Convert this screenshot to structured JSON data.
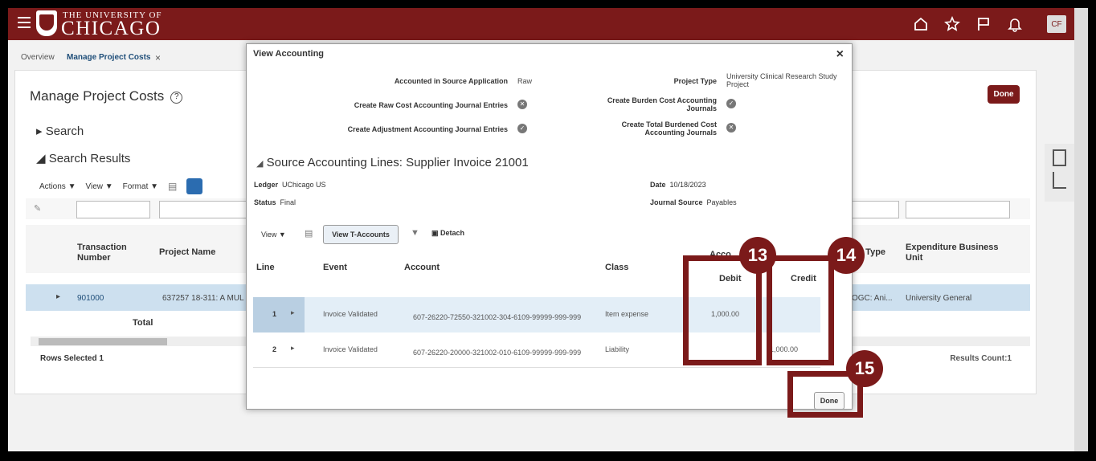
{
  "app": {
    "brand_top": "THE UNIVERSITY OF",
    "brand_main": "CHICAGO",
    "user_initials": "CF",
    "top_icons": [
      "home-icon",
      "star-icon",
      "flag-icon",
      "bell-icon"
    ]
  },
  "tabs": [
    {
      "label": "Overview"
    },
    {
      "label": "Manage Project Costs"
    }
  ],
  "page": {
    "title": "Manage Project Costs",
    "done_label": "Done",
    "search_label": "Search",
    "search_results_label": "Search Results",
    "toolbar": {
      "actions": "Actions",
      "view": "View",
      "format": "Format"
    },
    "headers": [
      "Transaction Number",
      "Project Name",
      "e Type",
      "Expenditure Business Unit"
    ],
    "row": {
      "transaction_number": "901000",
      "project_name": "637257 18-311: A MUL",
      "type_fragment": "OGC: Ani...",
      "business_unit": "University General"
    },
    "total_label": "Total",
    "rows_selected": "Rows Selected  1",
    "results_count": "Results Count:1"
  },
  "dialog": {
    "title": "View Accounting",
    "accounted_label": "Accounted in Source Application",
    "accounted_value": "Raw",
    "raw_cost_label": "Create Raw Cost Accounting Journal Entries",
    "adjustment_label": "Create Adjustment Accounting Journal Entries",
    "project_type_label": "Project Type",
    "project_type_value": "University Clinical Research Study Project",
    "burden_label": "Create Burden Cost Accounting Journals",
    "total_burdened_label": "Create Total Burdened Cost Accounting Journals",
    "section_title": "Source Accounting Lines: Supplier Invoice 21001",
    "ledger_label": "Ledger",
    "ledger_value": "UChicago US",
    "status_label": "Status",
    "status_value": "Final",
    "date_label": "Date",
    "date_value": "10/18/2023",
    "journal_source_label": "Journal Source",
    "journal_source_value": "Payables",
    "view_label": "View",
    "view_t_accounts": "View T-Accounts",
    "detach_label": "Detach",
    "columns": {
      "line": "Line",
      "event": "Event",
      "account": "Account",
      "class": "Class",
      "group": "Acco",
      "debit": "Debit",
      "credit": "Credit"
    },
    "lines": [
      {
        "line": "1",
        "event": "Invoice Validated",
        "account": "607-26220-72550-321002-304-6109-99999-999-999",
        "class": "Item expense",
        "debit": "1,000.00",
        "credit": ""
      },
      {
        "line": "2",
        "event": "Invoice Validated",
        "account": "607-26220-20000-321002-010-6109-99999-999-999",
        "class": "Liability",
        "debit": "",
        "credit": "1,000.00"
      }
    ],
    "done_label": "Done"
  },
  "callouts": [
    {
      "number": "13"
    },
    {
      "number": "14"
    },
    {
      "number": "15"
    }
  ],
  "colors": {
    "brand": "#7b1a1a",
    "selected_row": "#cde0ef"
  }
}
